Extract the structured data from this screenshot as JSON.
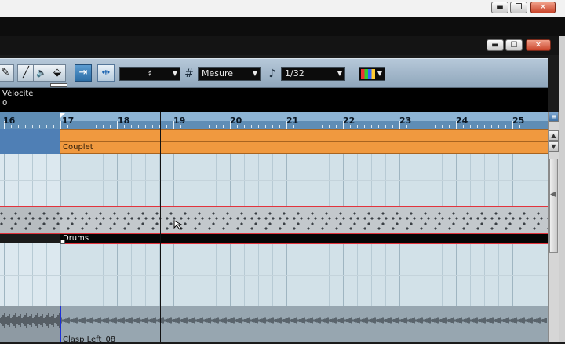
{
  "outer_window": {
    "buttons": [
      "▬",
      "❐",
      "✕"
    ]
  },
  "editor_window": {
    "buttons": [
      "▬",
      "☐",
      "✕"
    ]
  },
  "toolbar": {
    "tools": [
      {
        "name": "draw-tool",
        "icon": "pencil-icon",
        "glyph": "✎"
      },
      {
        "name": "line-tool",
        "icon": "line-icon",
        "glyph": "╱"
      },
      {
        "name": "speaker-tool",
        "icon": "speaker-icon",
        "glyph": "🔈"
      },
      {
        "name": "paint-tool",
        "icon": "paint-bucket-icon",
        "glyph": "⬙"
      }
    ],
    "auto_scroll_glyph": "⇥",
    "snap_glyph": "⇹",
    "grid_dropdown_value": "♯",
    "grid_type_value": "Mesure",
    "quantize_value": "1/32",
    "color_menu_glyph": "▦"
  },
  "info_line": {
    "label": "Vélocité",
    "value": "0"
  },
  "ruler": {
    "bars": [
      "16",
      "17",
      "18",
      "19",
      "20",
      "21",
      "22",
      "23",
      "24",
      "25"
    ]
  },
  "tracks": {
    "arranger_event": "Couplet",
    "drum_part": "Drums",
    "audio_event": "Clasp Left_08"
  },
  "colors": {
    "toolbar": "#9fb4c7",
    "ruler": "#5f8db5",
    "arranger": "#f0993f",
    "grid_bg": "#d2e1e8",
    "drum_border": "#e2333d"
  }
}
